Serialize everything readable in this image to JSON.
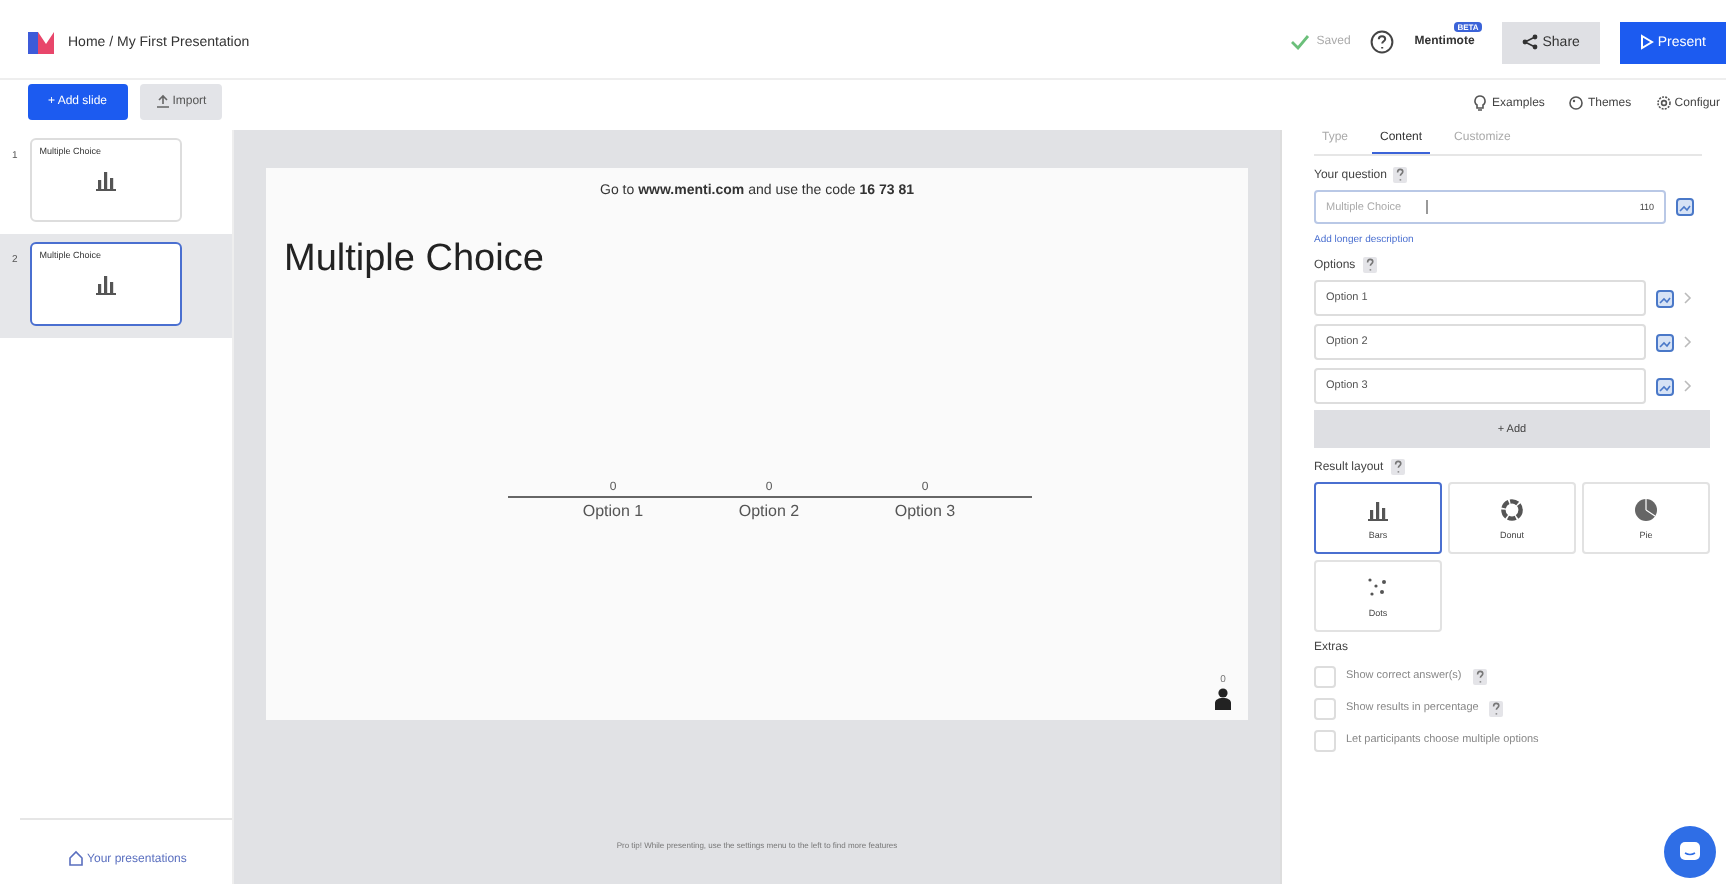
{
  "header": {
    "breadcrumb": "Home / My First Presentation",
    "saved": "Saved",
    "mentimote": "Mentimote",
    "badge": "BETA",
    "share": "Share",
    "present": "Present"
  },
  "toolbar": {
    "add_slide": "+ Add slide",
    "import": "Import",
    "links": [
      "Examples",
      "Themes",
      "Configur"
    ]
  },
  "slides": [
    {
      "number": "1",
      "title": "Multiple Choice",
      "selected": false
    },
    {
      "number": "2",
      "title": "Multiple Choice",
      "selected": true
    }
  ],
  "sidebar_footer": "Your presentations",
  "slide": {
    "instructions": "Go to **www.menti.com** and use the code **16 73 81**",
    "title": "Multiple Choice",
    "participants": "0",
    "results": [
      {
        "label": "Option 1",
        "count": "0"
      },
      {
        "label": "Option 2",
        "count": "0"
      },
      {
        "label": "Option 3",
        "count": "0"
      }
    ]
  },
  "footer_tip": "Pro tip! While presenting, use the settings menu to the left to find more features",
  "panel": {
    "tabs": [
      {
        "label": "Type",
        "selected": false
      },
      {
        "label": "Content",
        "selected": true
      },
      {
        "label": "Customize",
        "selected": false
      }
    ],
    "question_label": "Your question",
    "question": "Multiple Choice",
    "char_count": "110",
    "add_description": "Add longer description",
    "options_label": "Options",
    "options": [
      "Option 1",
      "Option 2",
      "Option 3"
    ],
    "add_option": "+ Add",
    "layout_label": "Result layout",
    "layouts": [
      {
        "kind": "bars",
        "label": "Bars",
        "selected": true
      },
      {
        "kind": "donut",
        "label": "Donut",
        "selected": false
      },
      {
        "kind": "pie",
        "label": "Pie",
        "selected": false
      },
      {
        "kind": "dots",
        "label": "Dots",
        "selected": false
      }
    ],
    "extras_label": "Extras",
    "extras": [
      {
        "label": "Show correct answer(s)",
        "checked": false,
        "help": true
      },
      {
        "label": "Show results in percentage",
        "checked": false,
        "help": true
      },
      {
        "label": "Let participants choose multiple options",
        "checked": false,
        "help": false
      }
    ]
  }
}
